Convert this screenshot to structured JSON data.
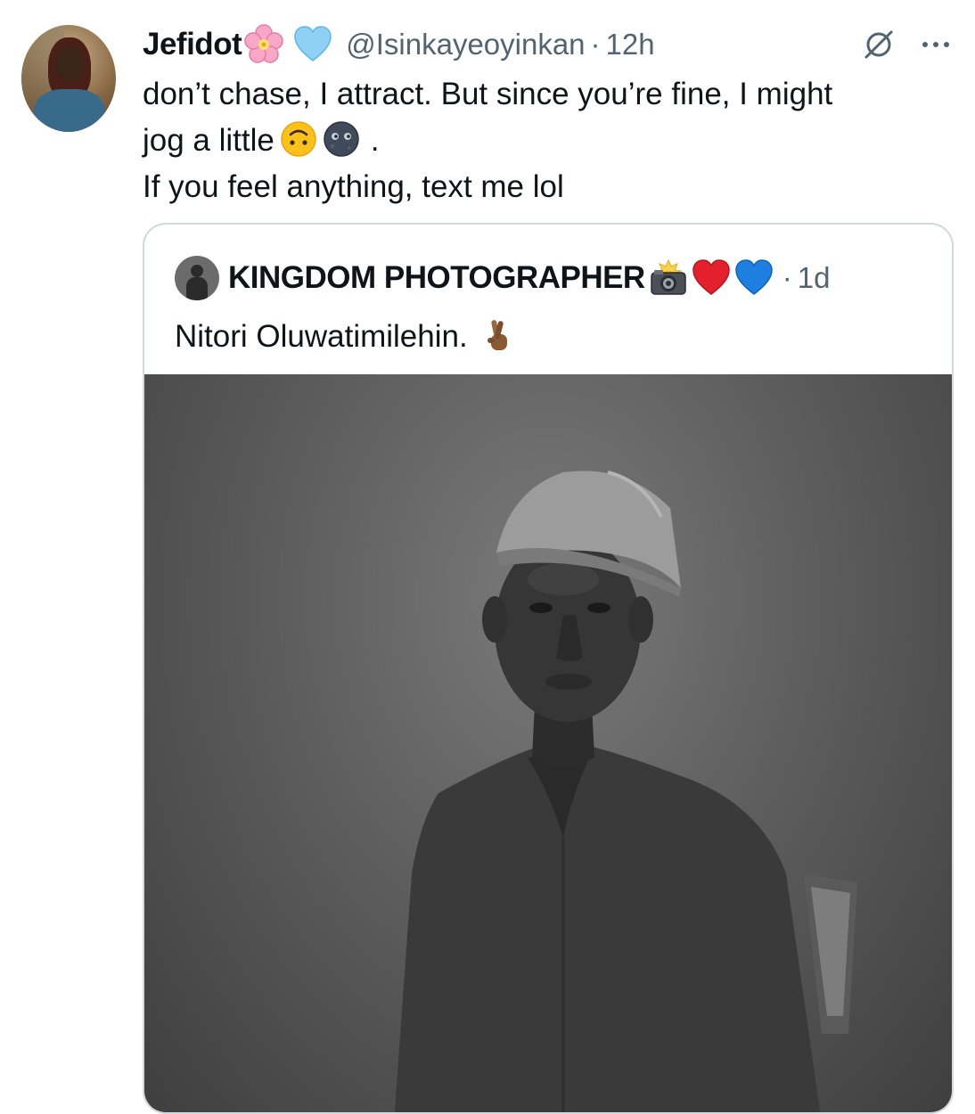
{
  "author": {
    "display_name": "Jefidot",
    "handle": "@Isinkayeoyinkan",
    "separator": "·",
    "time": "12h",
    "badges": [
      "cherry-blossom-emoji",
      "light-blue-heart-emoji"
    ]
  },
  "tweet": {
    "lines": [
      "don’t chase, I attract. But since you’re fine, I might",
      "jog a little",
      "If you feel anything, text me lol"
    ],
    "line2_suffix": ".",
    "inline_emojis": [
      "upside-down-face-emoji",
      "new-moon-face-emoji"
    ]
  },
  "actions": {
    "icons": [
      "grok-icon",
      "more-options-icon"
    ]
  },
  "quote": {
    "display_name": "KINGDOM PHOTOGRAPHER",
    "badges": [
      "camera-flash-emoji",
      "red-heart-emoji",
      "blue-heart-emoji"
    ],
    "separator": "·",
    "time": "1d",
    "text": "Nitori Oluwatimilehin.",
    "text_emoji": "crossed-fingers-emoji",
    "media": "black-and-white-portrait-photo"
  },
  "colors": {
    "text_primary": "#0f1419",
    "text_secondary": "#536471",
    "border": "#cfd9de",
    "background": "#ffffff"
  }
}
